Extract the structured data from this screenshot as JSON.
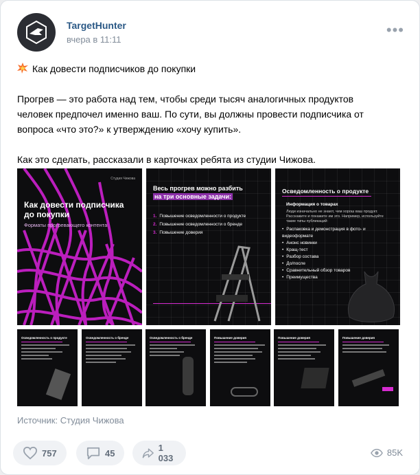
{
  "post": {
    "author": "TargetHunter",
    "date": "вчера в 11:11",
    "more_icon": "more-horizontal-icon",
    "title_line": "Как довести подписчиков до покупки",
    "title_emoji": "collision-emoji",
    "paragraph1_line1": "Прогрев — это работа над тем, чтобы среди тысяч аналогичных продуктов",
    "paragraph1_line2": "человек предпочел именно ваш. По сути, вы должны провести подписчика от",
    "paragraph1_line3": "вопроса «что это?» к утверждению «хочу купить».",
    "paragraph2": "Как это сделать, рассказали в карточках ребята из студии Чижова.",
    "source": "Источник: Студия Чижова"
  },
  "cards": {
    "card1": {
      "corner": "Студия Чижова",
      "title_line1": "Как довести подписчика",
      "title_line2": "до покупки",
      "subtitle": "Форматы прогревающего контента"
    },
    "card2": {
      "title_line1": "Весь прогрев можно разбить",
      "title_line2": "на три основные задачи:",
      "items": [
        {
          "n": "1.",
          "text": "Повышение осведомленности о продукте"
        },
        {
          "n": "2.",
          "text": "Повышение осведомленности о бренде"
        },
        {
          "n": "3.",
          "text": "Повышение доверия"
        }
      ]
    },
    "card3": {
      "title": "Осведомленность о продукте",
      "subtitle": "Информация о товарах",
      "intro": "Люди изначально не знают, чем хорош ваш продукт. Расскажите и покажите им это. Например, используйте такие типы публикаций:",
      "items": [
        "Распаковка и демонстрация в фото- и видеоформате",
        "Анонс новинки",
        "Кращ-тест",
        "Разбор состава",
        "До/после",
        "Сравнительный обзор товаров",
        "Преимущества"
      ]
    },
    "small": [
      "Осведомленность о продукте",
      "Осведомленность о бренде",
      "Осведомленность о бренде",
      "Повышение доверия",
      "Повышение доверия",
      "Повышение доверия"
    ]
  },
  "actions": {
    "likes": "757",
    "comments": "45",
    "shares": "1 033",
    "views": "85K"
  },
  "colors": {
    "accent": "#d52bd0",
    "link": "#2a5885",
    "muted": "#818c99"
  }
}
